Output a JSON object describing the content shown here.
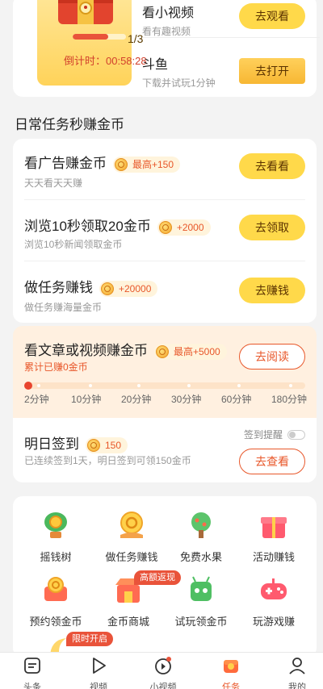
{
  "treasure": {
    "progress_text": "1/3",
    "progress": 0.66,
    "countdown": "倒计时：00:58:28"
  },
  "top_tasks": [
    {
      "title": "看小视频",
      "subtitle": "看有趣视频",
      "button": "去观看"
    },
    {
      "title": "斗鱼",
      "subtitle": "下载并试玩1分钟",
      "button": "去打开"
    }
  ],
  "section_title": "日常任务秒赚金币",
  "daily_tasks": [
    {
      "title": "看广告赚金币",
      "badge": "最高+150",
      "subtitle": "天天看天天赚",
      "button": "去看看"
    },
    {
      "title": "浏览10秒领取20金币",
      "badge": "+2000",
      "subtitle": "浏览10秒新闻领取金币",
      "button": "去领取"
    },
    {
      "title": "做任务赚钱",
      "badge": "+20000",
      "subtitle": "做任务赚海量金币",
      "button": "去赚钱"
    }
  ],
  "article_task": {
    "title": "看文章或视频赚金币",
    "badge": "最高+5000",
    "subtitle": "累计已赚0金币",
    "button": "去阅读",
    "milestones": [
      "2分钟",
      "10分钟",
      "20分钟",
      "30分钟",
      "60分钟",
      "180分钟"
    ]
  },
  "signin": {
    "title": "明日签到",
    "badge": "150",
    "subtitle": "已连续签到1天，明日签到可领150金币",
    "remind_label": "签到提醒",
    "remind_on": false,
    "button": "去查看"
  },
  "grid": [
    {
      "label": "摇钱树",
      "icon": "money-tree-icon"
    },
    {
      "label": "做任务赚钱",
      "icon": "coin-hand-icon"
    },
    {
      "label": "免费水果",
      "icon": "fruit-tree-icon"
    },
    {
      "label": "活动赚钱",
      "icon": "gift-box-icon"
    },
    {
      "label": "预约领金币",
      "icon": "coin-chest-icon"
    },
    {
      "label": "金币商城",
      "icon": "store-icon",
      "tag": "高额返现"
    },
    {
      "label": "试玩领金币",
      "icon": "robot-icon"
    },
    {
      "label": "玩游戏赚",
      "icon": "gamepad-icon"
    }
  ],
  "limited_tag": "限时开启",
  "tabs": [
    {
      "label": "头条",
      "icon": "news-icon"
    },
    {
      "label": "视频",
      "icon": "play-icon"
    },
    {
      "label": "小视频",
      "icon": "short-video-icon"
    },
    {
      "label": "任务",
      "icon": "task-icon"
    },
    {
      "label": "我的",
      "icon": "profile-icon"
    }
  ],
  "colors": {
    "accent_yellow": "#ffd94a",
    "accent_orange": "#e8572a",
    "active_tab": "#e8572a"
  }
}
